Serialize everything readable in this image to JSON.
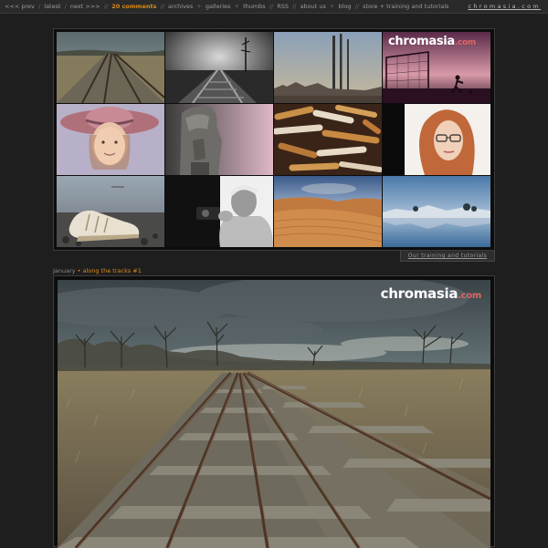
{
  "nav": {
    "prev": "<<< prev",
    "latest": "latest",
    "next": "next >>>",
    "comments": "20 comments",
    "archives": "archives",
    "galleries": "galleries",
    "thumbs": "thumbs",
    "rss": "RSS",
    "about": "about us",
    "blog": "blog",
    "store": "store + training and tutorials",
    "sep_slash": "/",
    "sep_double": "//",
    "sep_plus": "+",
    "brand": "chromasia.com"
  },
  "mosaic": {
    "tiles": [
      {
        "name": "tile-railway-tracks",
        "icon": "railway-photo"
      },
      {
        "name": "tile-dark-tracks",
        "icon": "railway-photo"
      },
      {
        "name": "tile-city-skyline",
        "icon": "cityscape-photo"
      },
      {
        "name": "tile-football-sunset",
        "icon": "silhouette-photo"
      },
      {
        "name": "tile-girl-hat",
        "icon": "portrait-photo"
      },
      {
        "name": "tile-stone-sculpture",
        "icon": "sculpture-photo"
      },
      {
        "name": "tile-cigarette-butts",
        "icon": "still-life-photo"
      },
      {
        "name": "tile-redhead-glasses",
        "icon": "portrait-photo"
      },
      {
        "name": "tile-sneakers-beach",
        "icon": "shoes-photo"
      },
      {
        "name": "tile-photographer",
        "icon": "portrait-photo"
      },
      {
        "name": "tile-desert-dunes",
        "icon": "landscape-photo"
      },
      {
        "name": "tile-lake-reflection",
        "icon": "landscape-photo"
      }
    ],
    "logo_main": "chromasia",
    "logo_suffix": ".com",
    "training_label": "Our training and tutorials"
  },
  "post": {
    "month": "January",
    "title": "along the tracks #1"
  },
  "photo": {
    "logo_main": "chromasia",
    "logo_suffix": ".com"
  },
  "colors": {
    "background": "#1e1e1e",
    "accent": "#d88a1a"
  }
}
